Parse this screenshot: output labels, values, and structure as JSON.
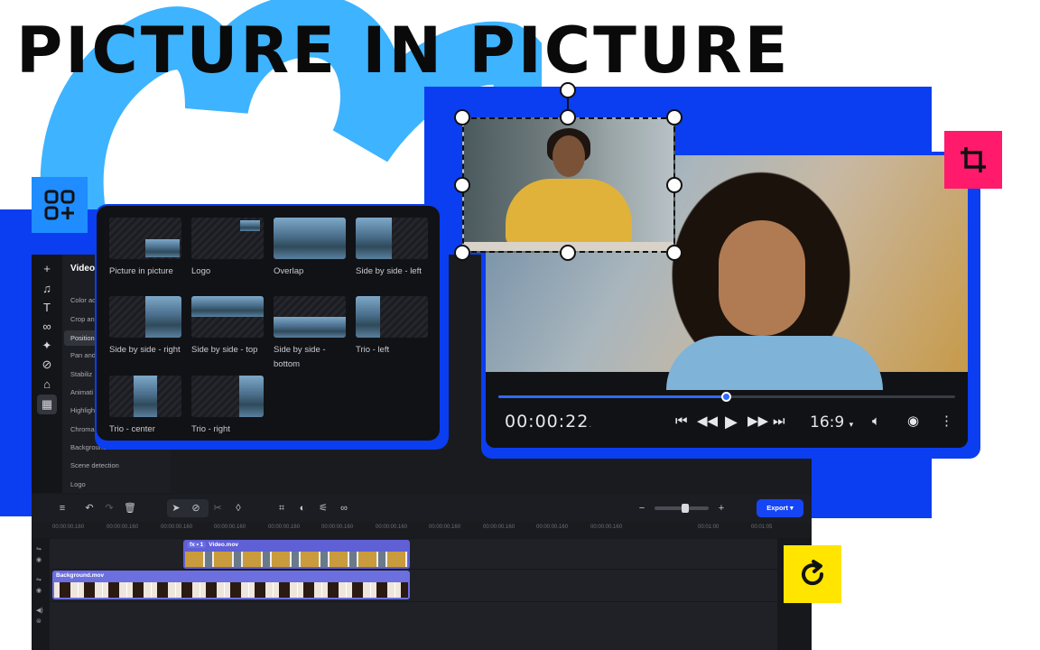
{
  "headline": "PICTURE IN PICTURE",
  "colors": {
    "brand_blue": "#0b3ef0",
    "accent_pink": "#ff1a6b",
    "accent_yellow": "#ffe500",
    "light_blue": "#3eb3ff"
  },
  "sidebar": {
    "title": "Video",
    "items": [
      "Color ac",
      "Crop an",
      "Position",
      "Pan and",
      "Stabiliz",
      "Animati",
      "Highligh",
      "Chroma",
      "Background",
      "Scene detection",
      "Logo"
    ],
    "selected": "Position",
    "rail_icons": [
      "plus-icon",
      "music-icon",
      "text-icon",
      "transitions-icon",
      "magic-icon",
      "filters-icon",
      "stickers-icon",
      "more-tools-icon"
    ]
  },
  "presets": [
    {
      "label": "Picture in picture"
    },
    {
      "label": "Logo"
    },
    {
      "label": "Overlap"
    },
    {
      "label": "Side by side - left"
    },
    {
      "label": "Side by side - right"
    },
    {
      "label": "Side by side - top"
    },
    {
      "label": "Side by side - bottom"
    },
    {
      "label": "Trio - left"
    },
    {
      "label": "Trio - center"
    },
    {
      "label": "Trio - right"
    }
  ],
  "player": {
    "timecode": "00:00:22",
    "timecode_suffix": ".",
    "ratio": "16:9",
    "progress": 0.5
  },
  "timeline": {
    "export_label": "Export",
    "ruler": [
      "00:00:00.160",
      "00:00:00.160",
      "00:00:00.160",
      "00:00:00.160",
      "00:00:00.160",
      "00:00:00.160",
      "00:00:00.160",
      "00:00:00.160",
      "00:00:00.160",
      "00:00:00.160",
      "00:00:00.160",
      "00:01:00",
      "00:01:05"
    ],
    "clips": {
      "video": "Video.mov",
      "video_fx": "fx • 1",
      "background": "Background.mov"
    }
  }
}
